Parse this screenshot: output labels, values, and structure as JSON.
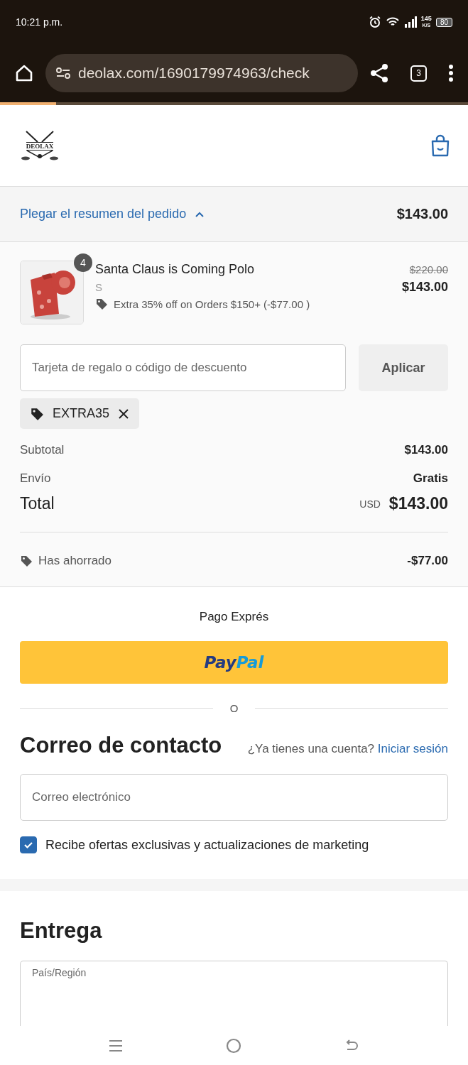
{
  "status_bar": {
    "time": "10:21 p.m.",
    "speed": "145",
    "speed_unit": "K/S",
    "battery": "80"
  },
  "browser": {
    "url": "deolax.com/1690179974963/check",
    "tab_count": "3",
    "progress": {
      "level": 0.12
    }
  },
  "header": {
    "logo_text": "DEOLAX"
  },
  "summary_toggle": {
    "label": "Plegar el resumen del pedido",
    "expanded": true,
    "total": "$143.00"
  },
  "items": [
    {
      "name": "Santa Claus is Coming Polo",
      "variant": "S",
      "quantity": "4",
      "discount": "Extra 35% off on Orders $150+ (-$77.00 )",
      "original_price": "$220.00",
      "price": "$143.00"
    }
  ],
  "discount_field": {
    "placeholder": "Tarjeta de regalo o código de descuento",
    "button": "Aplicar"
  },
  "applied_codes": [
    {
      "code": "EXTRA35"
    }
  ],
  "totals": [
    {
      "label": "Subtotal",
      "value": "$143.00"
    },
    {
      "label": "Envío",
      "value": "Gratis"
    }
  ],
  "total": {
    "label": "Total",
    "currency": "USD",
    "value": "$143.00"
  },
  "savings": {
    "label": "Has ahorrado",
    "value": "-$77.00"
  },
  "express": {
    "title": "Pago Exprés",
    "paypal_1": "Pay",
    "paypal_2": "Pal",
    "divider": "O"
  },
  "contact": {
    "title": "Correo de contacto",
    "prompt": "¿Ya tienes una cuenta?",
    "login": "Iniciar sesión",
    "email_placeholder": "Correo electrónico",
    "marketing_label": "Recibe ofertas exclusivas y actualizaciones de marketing",
    "marketing_checked": true
  },
  "delivery": {
    "title": "Entrega",
    "country_label": "País/Región"
  }
}
